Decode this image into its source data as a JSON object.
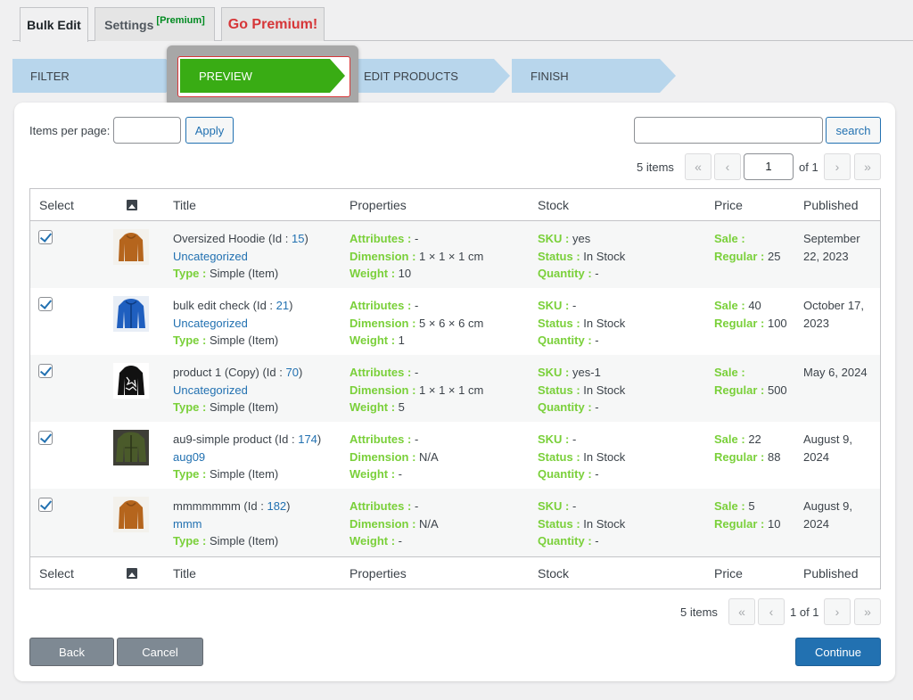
{
  "tabs": {
    "bulk_edit": "Bulk Edit",
    "settings": "Settings",
    "settings_badge": "[Premium]",
    "go_premium": "Go Premium!"
  },
  "steps": [
    "FILTER",
    "PREVIEW",
    "EDIT PRODUCTS",
    "FINISH"
  ],
  "toolbar": {
    "items_per_page_label": "Items per page:",
    "items_per_page_value": "",
    "apply_label": "Apply",
    "search_value": "",
    "search_label": "search"
  },
  "pagination_top": {
    "count": "5 items",
    "first": "«",
    "prev": "‹",
    "page": "1",
    "of": "of 1",
    "next": "›",
    "last": "»"
  },
  "pagination_bottom": {
    "count": "5 items",
    "first": "«",
    "prev": "‹",
    "page_text": "1 of 1",
    "next": "›",
    "last": "»"
  },
  "columns": [
    "Select",
    "Title",
    "Properties",
    "Stock",
    "Price",
    "Published"
  ],
  "labels": {
    "id": "Id :",
    "type": "Type :",
    "attributes": "Attributes :",
    "dimension": "Dimension :",
    "weight": "Weight :",
    "sku": "SKU :",
    "status": "Status :",
    "quantity": "Quantity :",
    "sale": "Sale :",
    "regular": "Regular :"
  },
  "rows": [
    {
      "checked": true,
      "image": "hoodie-orange",
      "name": "Oversized Hoodie",
      "id": "15",
      "category": "Uncategorized",
      "type": "Simple (Item)",
      "attributes": "-",
      "dimension": "1 × 1 × 1 cm",
      "weight": "10",
      "sku": "yes",
      "status": "In Stock",
      "quantity": "-",
      "sale": "",
      "regular": "25",
      "published_1": "September",
      "published_2": "22, 2023"
    },
    {
      "checked": true,
      "image": "jacket-blue",
      "name": "bulk edit check",
      "id": "21",
      "category": "Uncategorized",
      "type": "Simple (Item)",
      "attributes": "-",
      "dimension": "5 × 6 × 6 cm",
      "weight": "1",
      "sku": "-",
      "status": "In Stock",
      "quantity": "-",
      "sale": "40",
      "regular": "100",
      "published_1": "October 17,",
      "published_2": "2023"
    },
    {
      "checked": true,
      "image": "hoodie-black",
      "name": "product 1 (Copy)",
      "id": "70",
      "category": "Uncategorized",
      "type": "Simple (Item)",
      "attributes": "-",
      "dimension": "1 × 1 × 1 cm",
      "weight": "5",
      "sku": "yes-1",
      "status": "In Stock",
      "quantity": "-",
      "sale": "",
      "regular": "500",
      "published_1": "May 6, 2024",
      "published_2": ""
    },
    {
      "checked": true,
      "image": "jacket-green",
      "name": "au9-simple product",
      "id": "174",
      "category": "aug09",
      "type": "Simple (Item)",
      "attributes": "-",
      "dimension": "N/A",
      "weight": "-",
      "sku": "-",
      "status": "In Stock",
      "quantity": "-",
      "sale": "22",
      "regular": "88",
      "published_1": "August 9,",
      "published_2": "2024"
    },
    {
      "checked": true,
      "image": "hoodie-orange",
      "name": "mmmmmmm",
      "id": "182",
      "category": "mmm",
      "type": "Simple (Item)",
      "attributes": "-",
      "dimension": "N/A",
      "weight": "-",
      "sku": "-",
      "status": "In Stock",
      "quantity": "-",
      "sale": "5",
      "regular": "10",
      "published_1": "August 9,",
      "published_2": "2024"
    }
  ],
  "footer_buttons": {
    "back": "Back",
    "cancel": "Cancel",
    "continue": "Continue"
  },
  "colors": {
    "accent_green": "#39ac14",
    "label_green": "#7ad03a",
    "link_blue": "#2271b1",
    "step_blue": "#b8d6ec",
    "premium_red": "#d63638"
  }
}
